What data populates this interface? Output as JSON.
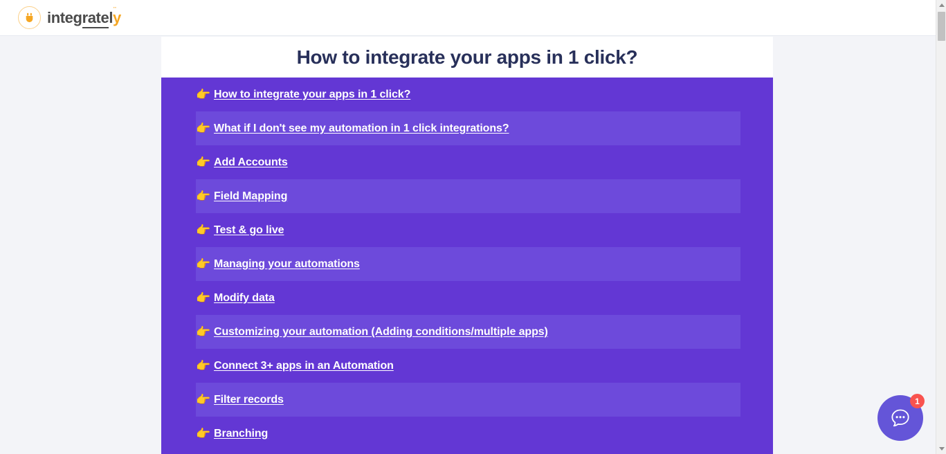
{
  "header": {
    "logo_text_1": "integ",
    "logo_text_2": "rate",
    "logo_text_3": "l",
    "logo_text_4": "y",
    "logo_dots": "¨",
    "logo_icon": "plug-icon"
  },
  "card": {
    "title": "How to integrate your apps in 1 click?"
  },
  "links": [
    {
      "icon": "👉",
      "label": "How to integrate your apps in 1 click?"
    },
    {
      "icon": "👉",
      "label": "What if I don't see my automation in 1 click integrations?"
    },
    {
      "icon": "👉",
      "label": "Add Accounts"
    },
    {
      "icon": "👉",
      "label": "Field Mapping"
    },
    {
      "icon": "👉",
      "label": "Test & go live"
    },
    {
      "icon": "👉",
      "label": "Managing your automations"
    },
    {
      "icon": "👉",
      "label": "Modify data"
    },
    {
      "icon": "👉",
      "label": "Customizing your automation (Adding conditions/multiple apps)"
    },
    {
      "icon": "👉",
      "label": "Connect 3+ apps in an Automation"
    },
    {
      "icon": "👉",
      "label": "Filter records"
    },
    {
      "icon": "👉",
      "label": "Branching"
    }
  ],
  "chat": {
    "badge_count": "1",
    "icon": "chat-bubble-icon"
  },
  "colors": {
    "panel_purple": "#6337d4",
    "panel_purple_alt": "#6d4adb",
    "title_navy": "#28305a",
    "brand_orange": "#f5a623",
    "badge_red": "#f9534f",
    "page_background": "#f3f4f8"
  }
}
